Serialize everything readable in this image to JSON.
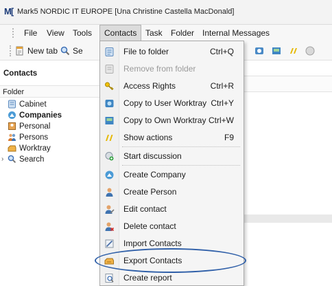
{
  "window": {
    "title": "Mark5 NORDIC IT EUROPE [Una Christine Castella MacDonald]"
  },
  "menubar": {
    "items": [
      "File",
      "View",
      "Tools",
      "Contacts",
      "Task",
      "Folder",
      "Internal Messages"
    ],
    "active": "Contacts"
  },
  "toolbar": {
    "new_tab_label": "New tab",
    "search_label_partial": "Se"
  },
  "left_panel": {
    "header": "Contacts",
    "folder_label": "Folder",
    "tree": [
      {
        "label": "Cabinet",
        "icon": "cabinet-icon",
        "bold": false
      },
      {
        "label": "Companies",
        "icon": "companies-icon",
        "bold": true
      },
      {
        "label": "Personal",
        "icon": "personal-icon",
        "bold": false
      },
      {
        "label": "Persons",
        "icon": "persons-icon",
        "bold": false
      },
      {
        "label": "Worktray",
        "icon": "worktray-icon",
        "bold": false
      },
      {
        "label": "Search",
        "icon": "search-icon",
        "bold": false,
        "expandable": true
      }
    ]
  },
  "contacts_menu": {
    "items": [
      {
        "label": "File to folder",
        "shortcut": "Ctrl+Q",
        "icon": "file-to-folder-icon",
        "enabled": true
      },
      {
        "label": "Remove from folder",
        "shortcut": "",
        "icon": "remove-from-folder-icon",
        "enabled": false
      },
      {
        "label": "Access Rights",
        "shortcut": "Ctrl+R",
        "icon": "key-icon",
        "enabled": true
      },
      {
        "label": "Copy to User Worktray",
        "shortcut": "Ctrl+Y",
        "icon": "copy-user-worktray-icon",
        "enabled": true
      },
      {
        "label": "Copy to Own Worktray",
        "shortcut": "Ctrl+W",
        "icon": "copy-own-worktray-icon",
        "enabled": true
      },
      {
        "label": "Show actions",
        "shortcut": "F9",
        "icon": "show-actions-icon",
        "enabled": true
      },
      {
        "label": "Start discussion",
        "shortcut": "",
        "icon": "start-discussion-icon",
        "enabled": true
      },
      {
        "label": "Create Company",
        "shortcut": "",
        "icon": "create-company-icon",
        "enabled": true
      },
      {
        "label": "Create Person",
        "shortcut": "",
        "icon": "create-person-icon",
        "enabled": true
      },
      {
        "label": "Edit contact",
        "shortcut": "",
        "icon": "edit-contact-icon",
        "enabled": true
      },
      {
        "label": "Delete contact",
        "shortcut": "",
        "icon": "delete-contact-icon",
        "enabled": true
      },
      {
        "label": "Import Contacts",
        "shortcut": "",
        "icon": "import-contacts-icon",
        "enabled": true
      },
      {
        "label": "Export Contacts",
        "shortcut": "",
        "icon": "export-contacts-icon",
        "enabled": true,
        "annotated": true
      },
      {
        "label": "Create report",
        "shortcut": "",
        "icon": "create-report-icon",
        "enabled": true
      }
    ]
  },
  "colors": {
    "annotation_ellipse": "#2f5fa8",
    "menu_background": "#f5f5f5",
    "disabled_text": "#9a9a9a"
  }
}
